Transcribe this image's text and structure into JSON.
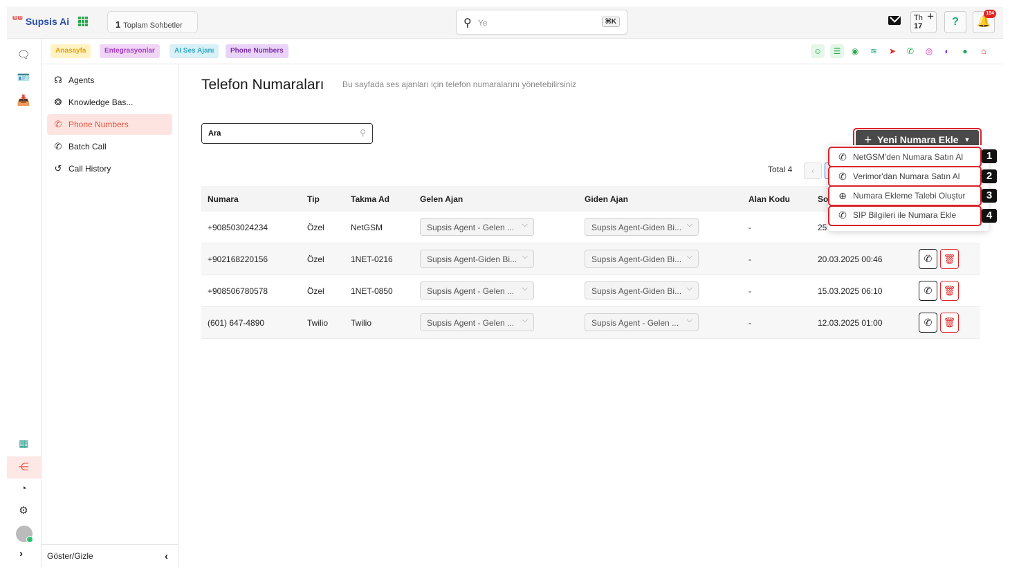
{
  "app": {
    "name": "Supsis Ai"
  },
  "header": {
    "chat_count": "1",
    "chat_label": "Toplam Sohbetler",
    "search_placeholder": "Ye",
    "shortcut": "⌘K",
    "day_name": "Th",
    "day_num": "17",
    "notif_count": "154"
  },
  "tabs": [
    {
      "label": "Anasayfa",
      "bg": "#fff3c4",
      "color": "#e5a10b"
    },
    {
      "label": "Entegrasyonlar",
      "bg": "#f1d5f7",
      "color": "#a33cc1"
    },
    {
      "label": "AI Ses Ajanı",
      "bg": "#d7f1f7",
      "color": "#33a6c0"
    },
    {
      "label": "Phone Numbers",
      "bg": "#ead3f8",
      "color": "#7a2ea6"
    }
  ],
  "subnav": {
    "items": [
      {
        "label": "Agents",
        "icon": "headset-icon"
      },
      {
        "label": "Knowledge Bas...",
        "icon": "brain-icon"
      },
      {
        "label": "Phone Numbers",
        "icon": "phone-icon"
      },
      {
        "label": "Batch Call",
        "icon": "phone-icon"
      },
      {
        "label": "Call History",
        "icon": "history-icon"
      }
    ],
    "footer": "Göster/Gizle"
  },
  "page": {
    "title": "Telefon Numaraları",
    "subtitle": "Bu sayfada ses ajanları için telefon numaralarını yönetebilirsiniz",
    "search_value": "Ara",
    "new_button": "Yeni Numara Ekle",
    "total": "Total 4"
  },
  "table": {
    "headers": [
      "Numara",
      "Tip",
      "Takma Ad",
      "Gelen Ajan",
      "Giden Ajan",
      "Alan Kodu",
      "So"
    ],
    "rows": [
      {
        "number": "+908503024234",
        "type": "Özel",
        "alias": "NetGSM",
        "incoming": "Supsis Agent - Gelen ...",
        "outgoing": "Supsis Agent-Giden Bi...",
        "area": "-",
        "date": "25"
      },
      {
        "number": "+902168220156",
        "type": "Özel",
        "alias": "1NET-0216",
        "incoming": "Supsis Agent-Giden Bi...",
        "outgoing": "Supsis Agent-Giden Bi...",
        "area": "-",
        "date": "20.03.2025 00:46"
      },
      {
        "number": "+908506780578",
        "type": "Özel",
        "alias": "1NET-0850",
        "incoming": "Supsis Agent - Gelen ...",
        "outgoing": "Supsis Agent-Giden Bi...",
        "area": "-",
        "date": "15.03.2025 06:10"
      },
      {
        "number": "(601) 647-4890",
        "type": "Twilio",
        "alias": "Twilio",
        "incoming": "Supsis Agent - Gelen ...",
        "outgoing": "Supsis Agent - Gelen ...",
        "area": "-",
        "date": "12.03.2025 01:00"
      }
    ]
  },
  "dropdown": {
    "items": [
      {
        "label": "NetGSM'den Numara Satın Al",
        "badge": "1",
        "icon": "phone-icon"
      },
      {
        "label": "Verimor'dan Numara Satın Al",
        "badge": "2",
        "icon": "phone-icon"
      },
      {
        "label": "Numara Ekleme Talebi Oluştur",
        "badge": "3",
        "icon": "plus-circle-icon"
      },
      {
        "label": "SIP Bilgileri ile Numara Ekle",
        "badge": "4",
        "icon": "phone-forward-icon"
      }
    ]
  },
  "colors": {
    "accent": "#e5533d",
    "highlight": "#d8232a",
    "button": "#4a4a4a"
  }
}
